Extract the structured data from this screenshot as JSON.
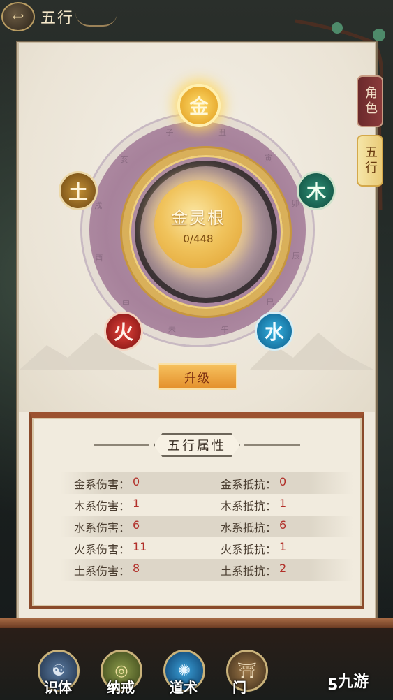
{
  "header": {
    "title": "五行"
  },
  "side_tabs": [
    {
      "label": "角色",
      "active": false
    },
    {
      "label": "五行",
      "active": true
    }
  ],
  "wheel": {
    "core_name": "金灵根",
    "core_progress": "0/448",
    "elements": {
      "metal": "金",
      "wood": "木",
      "water": "水",
      "fire": "火",
      "earth": "土"
    },
    "zodiac_outer": [
      "丑",
      "寅",
      "卯",
      "辰",
      "巳",
      "午",
      "未",
      "申",
      "酉",
      "戌",
      "亥",
      "子"
    ]
  },
  "upgrade_button": "升级",
  "attributes": {
    "title": "五行属性",
    "rows": [
      {
        "dmg_label": "金系伤害：",
        "dmg": "0",
        "res_label": "金系抵抗：",
        "res": "0"
      },
      {
        "dmg_label": "木系伤害：",
        "dmg": "1",
        "res_label": "木系抵抗：",
        "res": "1"
      },
      {
        "dmg_label": "水系伤害：",
        "dmg": "6",
        "res_label": "水系抵抗：",
        "res": "6"
      },
      {
        "dmg_label": "火系伤害：",
        "dmg": "11",
        "res_label": "火系抵抗：",
        "res": "1"
      },
      {
        "dmg_label": "土系伤害：",
        "dmg": "8",
        "res_label": "土系抵抗：",
        "res": "2"
      }
    ]
  },
  "bottom_nav": [
    {
      "label": "识体"
    },
    {
      "label": "纳戒"
    },
    {
      "label": "道术"
    },
    {
      "label": "门"
    }
  ],
  "watermark": "九游",
  "colors": {
    "accent_gold": "#e0a030",
    "value_red": "#b2302a",
    "frame_brown": "#8a4a2a"
  }
}
